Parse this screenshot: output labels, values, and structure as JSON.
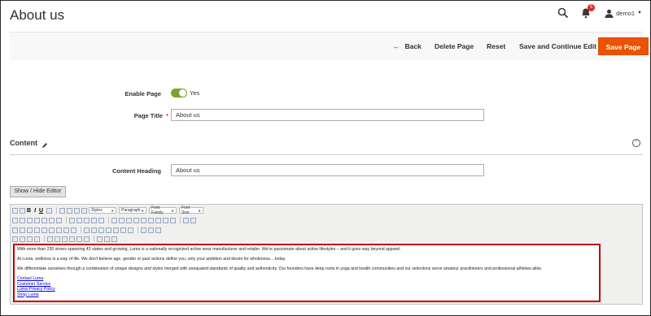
{
  "page": {
    "title": "About us"
  },
  "header": {
    "notification_count": "5",
    "user_name": "demo1"
  },
  "actions": {
    "back": "Back",
    "delete": "Delete Page",
    "reset": "Reset",
    "save_continue": "Save and Continue Edit",
    "save": "Save Page"
  },
  "form": {
    "enable_page": {
      "label": "Enable Page",
      "value": "Yes",
      "enabled": true
    },
    "page_title": {
      "label": "Page Title",
      "value": "About us"
    }
  },
  "content_section": {
    "title": "Content",
    "heading_label": "Content Heading",
    "heading_value": "About us",
    "show_hide_label": "Show / Hide Editor"
  },
  "editor": {
    "toolbar": {
      "selects": [
        "Styles",
        "Paragraph",
        "Font Family",
        "Font Size"
      ]
    },
    "paragraphs": [
      "With more than 230 stores spanning 43 states and growing, Luma is a nationally recognized active wear manufacturer and retailer. We're passionate about active lifestyles – and it goes way beyond apparel.",
      "At Luma, wellness is a way of life. We don't believe age, gender or past actions define you, only your ambition and desire for wholeness... today.",
      "We differentiate ourselves through a combination of unique designs and styles merged with unequaled standards of quality and authenticity. Our founders have deep roots in yoga and health communities and our selections serve amateur practitioners and professional athletes alike."
    ],
    "links": [
      "Contact Luma",
      "Customer Service",
      "Luma Privacy Policy",
      "Shop Luma"
    ]
  },
  "colors": {
    "accent": "#eb5202",
    "toggle_on": "#79a22e",
    "highlight_border": "#c00000"
  }
}
